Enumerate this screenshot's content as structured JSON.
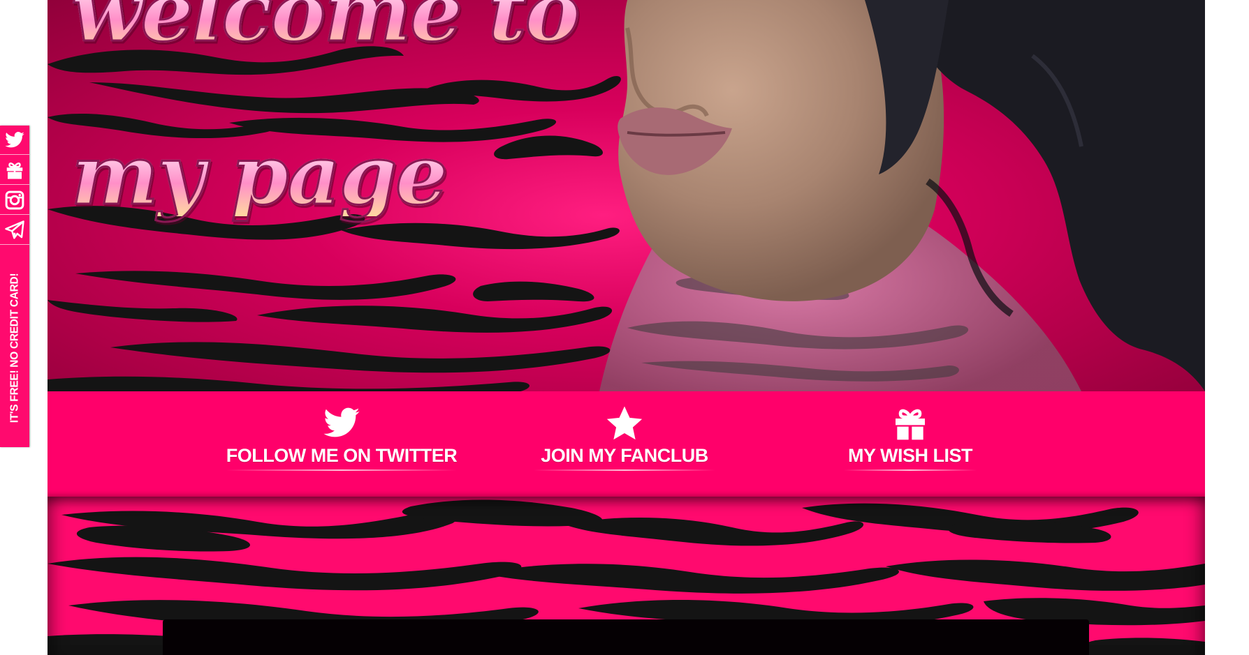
{
  "hero": {
    "title_line1": "welcome to",
    "title_line2": "my page"
  },
  "side_bar": {
    "icons": [
      "twitter-icon",
      "gift-icon",
      "instagram-icon",
      "telegram-icon"
    ],
    "promo_text": "IT'S FREE! NO CREDIT CARD!"
  },
  "nav": {
    "items": [
      {
        "icon": "twitter-icon",
        "label": "FOLLOW ME ON TWITTER"
      },
      {
        "icon": "star-icon",
        "label": "JOIN MY FANCLUB"
      },
      {
        "icon": "gift-icon",
        "label": "MY WISH LIST"
      }
    ]
  },
  "colors": {
    "accent_pink": "#ff006a",
    "zebra_stripe": "#111111",
    "text_white": "#ffffff",
    "content_box": "#050003"
  }
}
